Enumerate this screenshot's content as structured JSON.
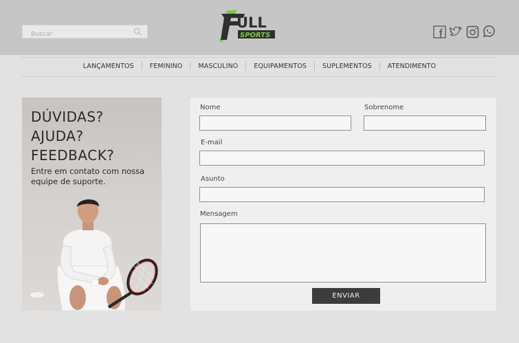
{
  "header": {
    "search": {
      "placeholder": "Buscar",
      "value": ""
    },
    "logo": {
      "text_main": "ULL",
      "text_sub": "SPORTS",
      "colors": {
        "dark": "#2f2f2f",
        "green": "#7ac943"
      }
    },
    "social": [
      {
        "name": "facebook-icon"
      },
      {
        "name": "twitter-icon"
      },
      {
        "name": "instagram-icon"
      },
      {
        "name": "whatsapp-icon"
      }
    ]
  },
  "nav": {
    "items": [
      {
        "label": "LANÇAMENTOS"
      },
      {
        "label": "FEMININO"
      },
      {
        "label": "MASCULINO"
      },
      {
        "label": "EQUIPAMENTOS"
      },
      {
        "label": "SUPLEMENTOS"
      },
      {
        "label": "ATENDIMENTO"
      }
    ]
  },
  "promo": {
    "heading_lines": [
      "DÚVIDAS?",
      "AJUDA?",
      "FEEDBACK?"
    ],
    "text_lines": [
      "Entre em contato com nossa",
      "equipe de suporte."
    ]
  },
  "form": {
    "nome_label": "Nome",
    "sobrenome_label": "Sobrenome",
    "email_label": "E-mail",
    "asunto_label": "Asunto",
    "mensagem_label": "Mensagem",
    "submit_label": "ENVIAR",
    "nome_value": "",
    "sobrenome_value": "",
    "email_value": "",
    "asunto_value": "",
    "mensagem_value": ""
  },
  "colors": {
    "header_bg": "#c6c6c6",
    "page_bg": "#e2e2e2",
    "panel_bg": "#efefef",
    "button_bg": "#3c3c3c"
  }
}
